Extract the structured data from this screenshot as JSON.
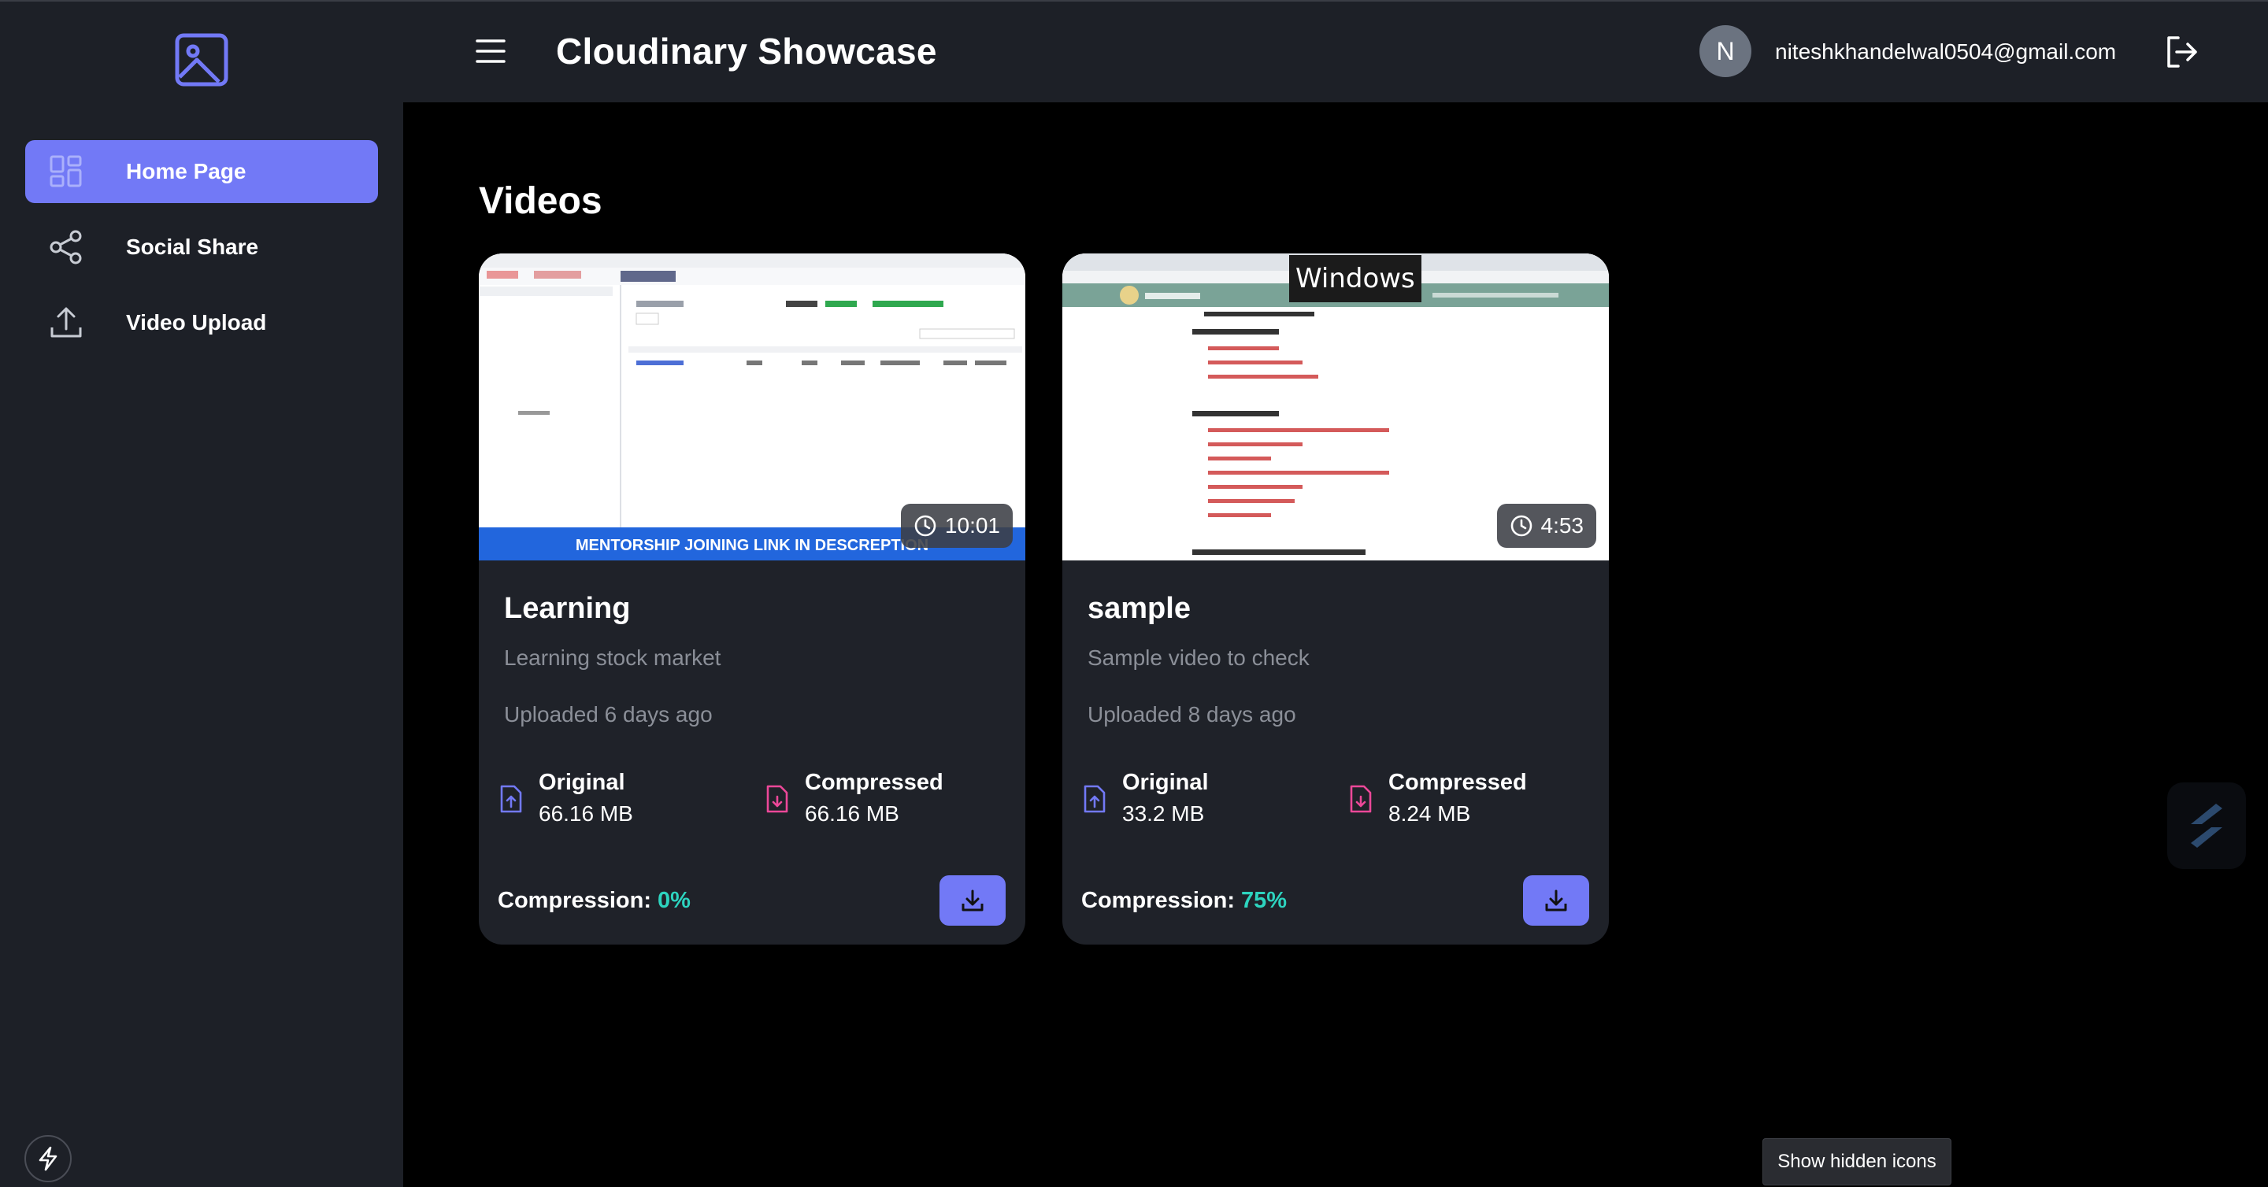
{
  "header": {
    "title": "Cloudinary Showcase",
    "user_initial": "N",
    "user_email": "niteshkhandelwal0504@gmail.com"
  },
  "sidebar": {
    "items": [
      {
        "label": "Home Page",
        "icon": "dashboard-grid-icon",
        "active": true
      },
      {
        "label": "Social Share",
        "icon": "share-icon",
        "active": false
      },
      {
        "label": "Video Upload",
        "icon": "upload-icon",
        "active": false
      }
    ]
  },
  "main": {
    "section_title": "Videos",
    "videos": [
      {
        "title": "Learning",
        "description": "Learning stock market",
        "uploaded": "Uploaded 6 days ago",
        "duration": "10:01",
        "original_label": "Original",
        "original_size": "66.16 MB",
        "compressed_label": "Compressed",
        "compressed_size": "66.16 MB",
        "compression_label": "Compression:",
        "compression_value": "0%",
        "thumb_banner": "MENTORSHIP JOINING LINK IN DESCREPTION"
      },
      {
        "title": "sample",
        "description": "Sample video to check",
        "uploaded": "Uploaded 8 days ago",
        "duration": "4:53",
        "original_label": "Original",
        "original_size": "33.2 MB",
        "compressed_label": "Compressed",
        "compressed_size": "8.24 MB",
        "compression_label": "Compression:",
        "compression_value": "75%",
        "thumb_overlay": "Windows"
      }
    ]
  },
  "tooltip": "Show hidden icons",
  "colors": {
    "accent": "#7279f6",
    "compression_pct": "#2dd4bf",
    "compressed_icon": "#ec4899",
    "panel": "#1d2027",
    "card": "#1f2229"
  }
}
